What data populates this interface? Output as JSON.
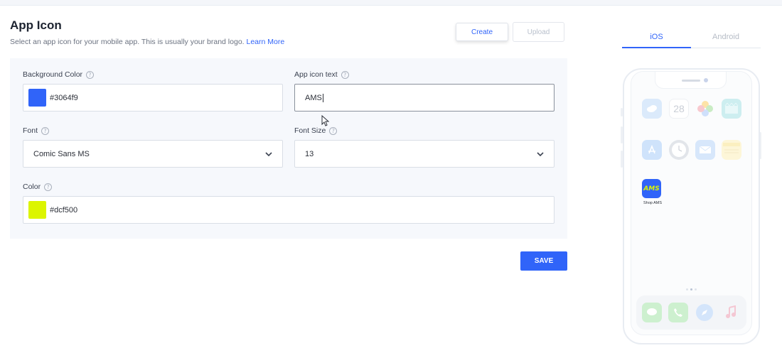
{
  "header": {
    "title": "App Icon",
    "subtitle": "Select an app icon for your mobile app. This is usually your brand logo.",
    "learn_more": "Learn More"
  },
  "actions": {
    "create_label": "Create",
    "upload_label": "Upload",
    "save_label": "SAVE"
  },
  "form": {
    "background_color": {
      "label": "Background Color",
      "value": "#3064f9",
      "swatch": "#3064f9"
    },
    "icon_text": {
      "label": "App icon text",
      "value": "AMS"
    },
    "font": {
      "label": "Font",
      "value": "Comic Sans MS"
    },
    "font_size": {
      "label": "Font Size",
      "value": "13"
    },
    "color": {
      "label": "Color",
      "value": "#dcf500",
      "swatch": "#dcf500"
    },
    "help_glyph": "?"
  },
  "preview": {
    "tabs": [
      {
        "label": "iOS",
        "active": true
      },
      {
        "label": "Android",
        "active": false
      }
    ],
    "calendar_day": "28",
    "app_icon_text": "AMS",
    "app_label": "Shop AMS",
    "app_icon_bg": "#3064f9",
    "app_icon_fg": "#dcf500"
  },
  "colors": {
    "accent": "#3064f9",
    "panel": "#f6f8fc"
  }
}
